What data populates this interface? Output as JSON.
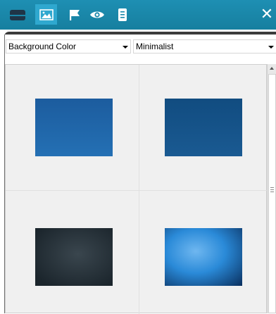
{
  "toolbar": {
    "buttons": [
      {
        "icon": "layers-icon",
        "active": false
      },
      {
        "icon": "image-icon",
        "active": true
      },
      {
        "icon": "flag-icon",
        "active": false
      },
      {
        "icon": "eye-icon",
        "active": false
      },
      {
        "icon": "scroll-icon",
        "active": false
      }
    ],
    "close_symbol": "✕"
  },
  "filters": {
    "category": "Background Color",
    "style": "Minimalist"
  },
  "gallery": {
    "thumbnails": [
      {
        "style": "solid-blue",
        "colors": [
          "#1c5c9e",
          "#2470b4"
        ]
      },
      {
        "style": "navy-blue",
        "colors": [
          "#114c80",
          "#1a5a92"
        ]
      },
      {
        "style": "dark-slate",
        "colors": [
          "#1b252c",
          "#3a464e"
        ]
      },
      {
        "style": "glowing-blue",
        "colors": [
          "#0a2f5e",
          "#6fb7f0"
        ]
      }
    ]
  },
  "colors": {
    "toolbar_bg": "#1a88ab",
    "toolbar_active": "#2fa8cf",
    "panel_bg": "#f0f0f0"
  }
}
